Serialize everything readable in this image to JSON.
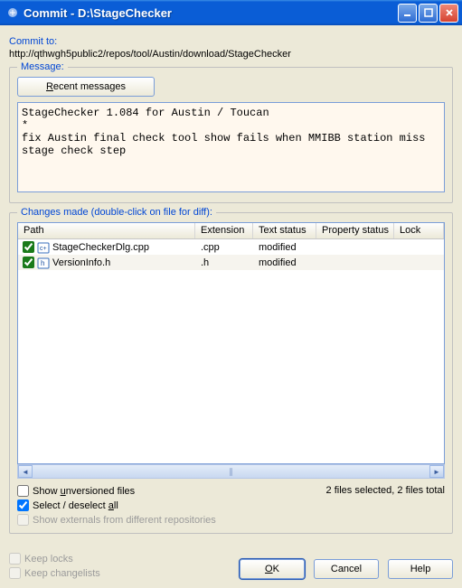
{
  "window": {
    "title": "Commit - D:\\StageChecker"
  },
  "commit": {
    "label": "Commit to:",
    "url": "http://qthwgh5public2/repos/tool/Austin/download/StageChecker"
  },
  "message": {
    "group_title": "Message:",
    "recent_btn_prefix": "R",
    "recent_btn_rest": "ecent messages",
    "text": "StageChecker 1.084 for Austin / Toucan\n*\nfix Austin final check tool show fails when MMIBB station miss stage check step"
  },
  "changes": {
    "group_title": "Changes made (double-click on file for diff):",
    "columns": {
      "path": "Path",
      "extension": "Extension",
      "text_status": "Text status",
      "property_status": "Property status",
      "lock": "Lock"
    },
    "files": [
      {
        "checked": true,
        "icon_type": "cpp",
        "name": "StageCheckerDlg.cpp",
        "ext": ".cpp",
        "status": "modified",
        "prop": "",
        "lock": ""
      },
      {
        "checked": true,
        "icon_type": "h",
        "name": "VersionInfo.h",
        "ext": ".h",
        "status": "modified",
        "prop": "",
        "lock": ""
      }
    ],
    "status_text": "2 files selected, 2 files total"
  },
  "options": {
    "show_unversioned_pre": "Show ",
    "show_unversioned_u": "u",
    "show_unversioned_post": "nversioned files",
    "show_unversioned_checked": false,
    "select_all_pre": "Select / deselect ",
    "select_all_u": "a",
    "select_all_post": "ll",
    "select_all_checked": true,
    "show_externals": "Show externals from different repositories",
    "keep_locks": "Keep locks",
    "keep_changelists": "Keep changelists"
  },
  "buttons": {
    "ok_u": "O",
    "ok_rest": "K",
    "cancel": "Cancel",
    "help": "Help"
  }
}
